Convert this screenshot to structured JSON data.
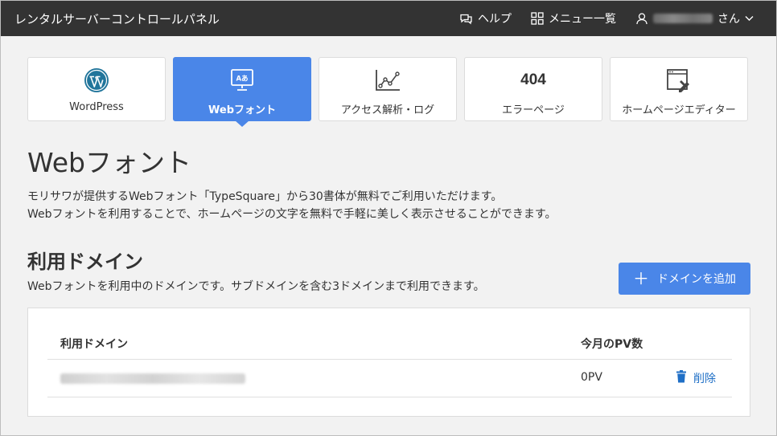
{
  "header": {
    "brand": "レンタルサーバーコントロールパネル",
    "help_label": "ヘルプ",
    "menu_label": "メニュー一覧",
    "user_suffix": "さん"
  },
  "tiles": [
    {
      "label": "WordPress",
      "icon": "wordpress-icon",
      "active": false
    },
    {
      "label": "Webフォント",
      "icon": "webfont-icon",
      "active": true
    },
    {
      "label": "アクセス解析・ログ",
      "icon": "chart-line-icon",
      "active": false
    },
    {
      "label": "エラーページ",
      "icon": "error-404-icon",
      "code": "404",
      "active": false
    },
    {
      "label": "ホームページエディター",
      "icon": "page-editor-icon",
      "active": false
    }
  ],
  "main": {
    "title": "Webフォント",
    "desc_line1": "モリサワが提供するWebフォント「TypeSquare」から30書体が無料でご利用いただけます。",
    "desc_line2": "Webフォントを利用することで、ホームページの文字を無料で手軽に美しく表示させることができます。",
    "section_title": "利用ドメイン",
    "section_desc": "Webフォントを利用中のドメインです。サブドメインを含む3ドメインまで利用できます。",
    "add_button": "ドメインを追加"
  },
  "table": {
    "col_domain": "利用ドメイン",
    "col_pv": "今月のPV数",
    "rows": [
      {
        "pv": "0PV",
        "delete_label": "削除"
      }
    ]
  },
  "colors": {
    "accent": "#4a86e8",
    "header_bg": "#333333",
    "link": "#1f6fc6"
  }
}
